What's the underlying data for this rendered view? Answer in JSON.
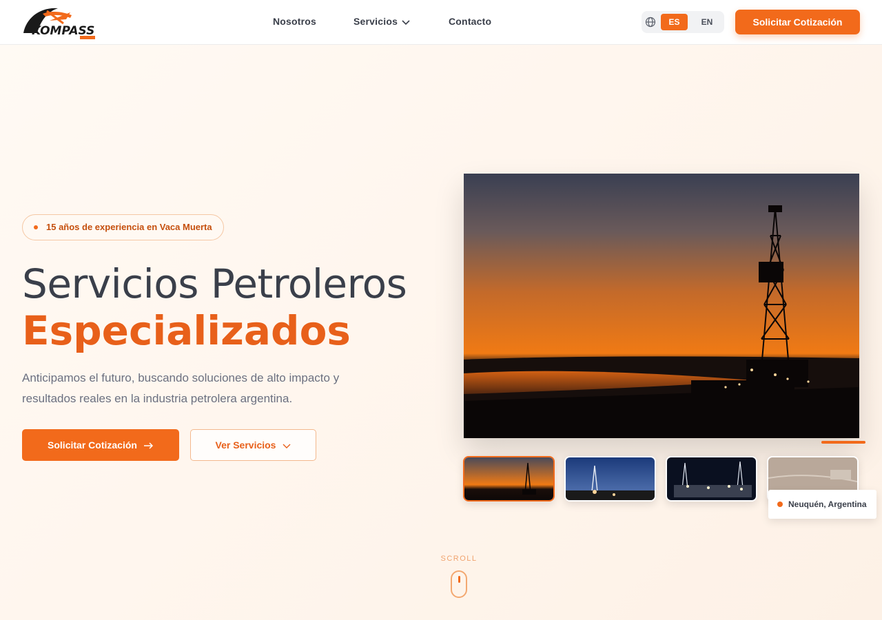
{
  "brand": {
    "name": "KOMPASS",
    "accent": "#f26a1b"
  },
  "nav": {
    "links": [
      {
        "label": "Nosotros"
      },
      {
        "label": "Servicios",
        "has_dropdown": true
      },
      {
        "label": "Contacto"
      }
    ],
    "language": {
      "options": [
        "ES",
        "EN"
      ],
      "selected": "ES",
      "icon": "globe-icon"
    },
    "cta_label": "Solicitar Cotización"
  },
  "hero": {
    "badge": "15 años de experiencia en Vaca Muerta",
    "title_line1": "Servicios Petroleros",
    "title_line2": "Especializados",
    "lead": "Anticipamos el futuro, buscando soluciones de alto impacto y resultados reales en la industria petrolera argentina.",
    "primary_button": "Solicitar Cotización",
    "secondary_button": "Ver Servicios",
    "location": "Neuquén, Argentina",
    "gallery": {
      "count": 4,
      "active_index": 0
    }
  },
  "scroll": {
    "label": "SCROLL"
  }
}
